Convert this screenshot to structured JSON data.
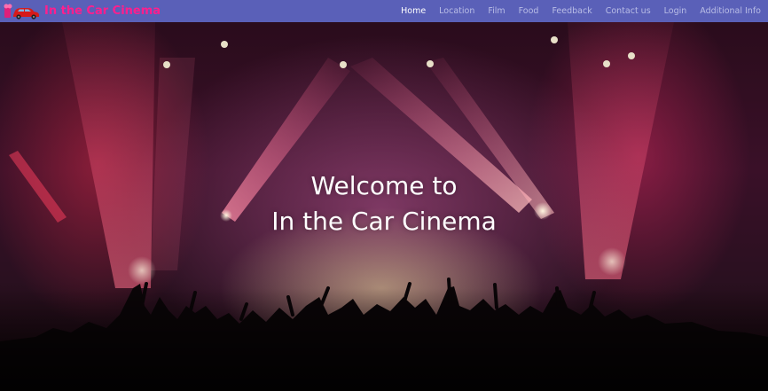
{
  "navbar": {
    "brand": "In the Car Cinema",
    "background": "#5a60b8",
    "brand_color": "#ff1f8e",
    "logo_icon": "car-logo-icon",
    "links": [
      {
        "label": "Home",
        "active": true
      },
      {
        "label": "Location",
        "active": false
      },
      {
        "label": "Film",
        "active": false
      },
      {
        "label": "Food",
        "active": false
      },
      {
        "label": "Feedback",
        "active": false
      },
      {
        "label": "Contact us",
        "active": false
      },
      {
        "label": "Login",
        "active": false
      },
      {
        "label": "Additional Info",
        "active": false
      }
    ]
  },
  "hero": {
    "line1": "Welcome to",
    "line2": "In the Car Cinema"
  }
}
